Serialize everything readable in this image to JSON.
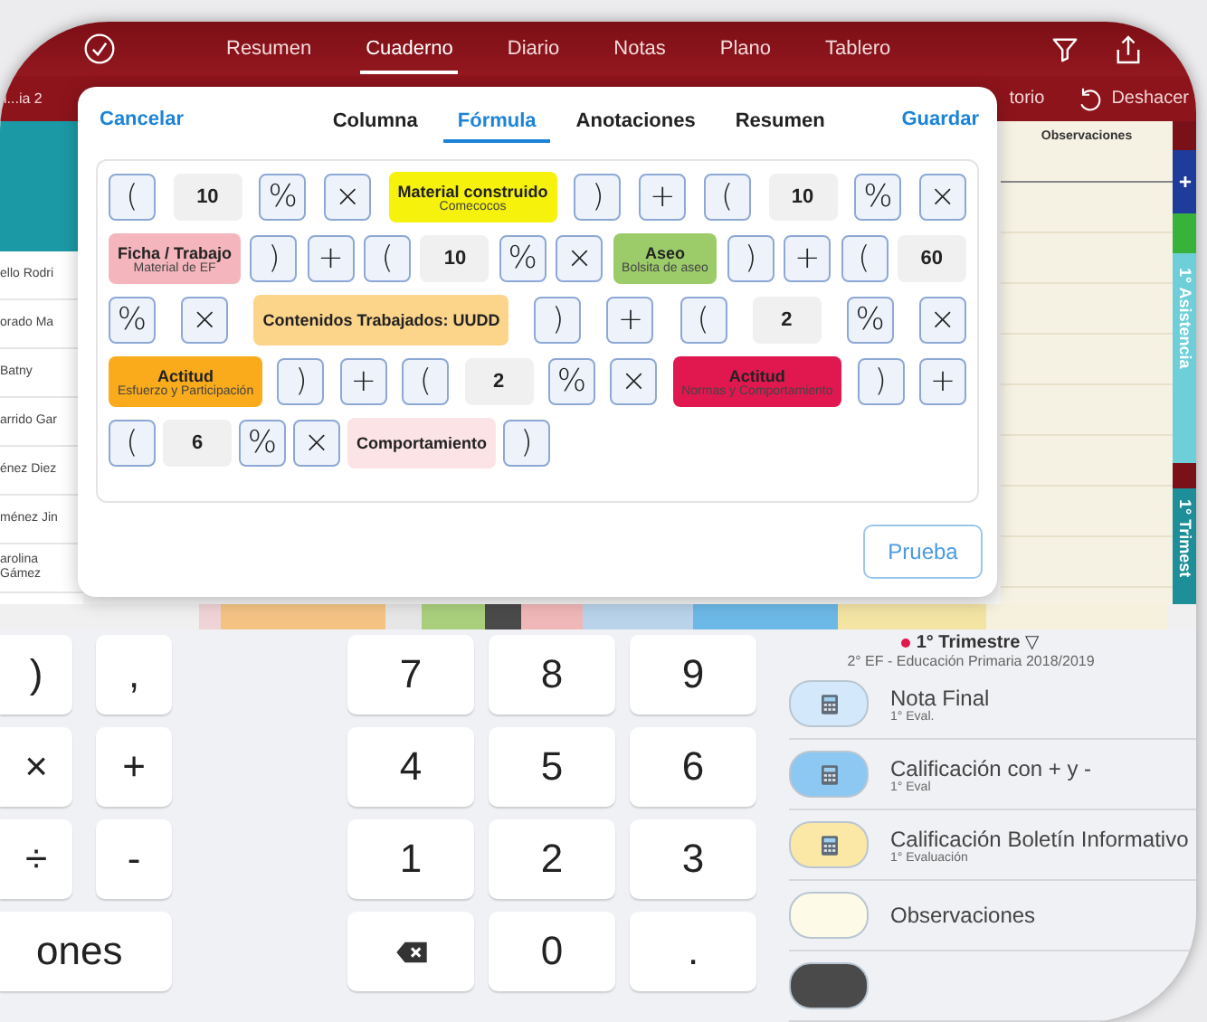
{
  "nav": {
    "tabs": [
      {
        "label": "Resumen",
        "selected": false
      },
      {
        "label": "Cuaderno",
        "selected": true
      },
      {
        "label": "Diario",
        "selected": false
      },
      {
        "label": "Notas",
        "selected": false
      },
      {
        "label": "Plano",
        "selected": false
      },
      {
        "label": "Tablero",
        "selected": false
      }
    ]
  },
  "toolbar": {
    "left_text": "i...ia 2",
    "right_text": "torio",
    "undo": "Deshacer"
  },
  "table": {
    "column_header": "Observaciones",
    "names": [
      "ello Rodri",
      "orado Ma",
      "Batny",
      "arrido Gar",
      "énez Diez",
      "ménez Jin",
      "arolina Gámez"
    ],
    "side_tabs": [
      {
        "label": "+",
        "color": "#1f3c9a"
      },
      {
        "color": "#38b23a"
      },
      {
        "label": "1° Asistencia",
        "color": "#6fcfd8"
      },
      {
        "label": "1° Trimest",
        "color": "#1e8e98"
      }
    ],
    "color_strip": [
      {
        "color": "#f0d3d7"
      },
      {
        "color": "#f4c384"
      },
      {
        "color": "#e6e6e6"
      },
      {
        "color": "#a9cf7c"
      },
      {
        "color": "#4a4a4a"
      },
      {
        "color": "#f0b7b8"
      },
      {
        "color": "#b8d3ea"
      },
      {
        "color": "#6cb8e6"
      },
      {
        "color": "#f3e4a4"
      },
      {
        "color": "#f6f1dc"
      }
    ]
  },
  "dialog": {
    "cancel": "Cancelar",
    "save": "Guardar",
    "tabs": [
      {
        "label": "Columna",
        "selected": false
      },
      {
        "label": "Fórmula",
        "selected": true
      },
      {
        "label": "Anotaciones",
        "selected": false
      },
      {
        "label": "Resumen",
        "selected": false
      }
    ],
    "formula": [
      {
        "tokens": [
          {
            "kind": "sym",
            "text": "("
          },
          {
            "kind": "num",
            "text": "10"
          },
          {
            "kind": "sym",
            "text": "%"
          },
          {
            "kind": "sym",
            "text": "×"
          },
          {
            "kind": "item",
            "title": "Material construido",
            "subtitle": "Comecocos",
            "color": "#f6f20c"
          },
          {
            "kind": "sym",
            "text": ")"
          },
          {
            "kind": "sym",
            "text": "+"
          },
          {
            "kind": "sym",
            "text": "("
          },
          {
            "kind": "num",
            "text": "10"
          },
          {
            "kind": "sym",
            "text": "%"
          },
          {
            "kind": "sym",
            "text": "×"
          }
        ]
      },
      {
        "tokens": [
          {
            "kind": "item",
            "title": "Ficha / Trabajo",
            "subtitle": "Material de EF",
            "color": "#f4b6bc"
          },
          {
            "kind": "sym",
            "text": ")"
          },
          {
            "kind": "sym",
            "text": "+"
          },
          {
            "kind": "sym",
            "text": "("
          },
          {
            "kind": "num",
            "text": "10"
          },
          {
            "kind": "sym",
            "text": "%"
          },
          {
            "kind": "sym",
            "text": "×"
          },
          {
            "kind": "item",
            "title": "Aseo",
            "subtitle": "Bolsita de aseo",
            "color": "#9ccc6a"
          },
          {
            "kind": "sym",
            "text": ")"
          },
          {
            "kind": "sym",
            "text": "+"
          },
          {
            "kind": "sym",
            "text": "("
          },
          {
            "kind": "num",
            "text": "60"
          }
        ]
      },
      {
        "tokens": [
          {
            "kind": "sym",
            "text": "%"
          },
          {
            "kind": "sym",
            "text": "×"
          },
          {
            "kind": "item",
            "title": "Contenidos Trabajados: UUDD",
            "color": "#fcd48a"
          },
          {
            "kind": "sym",
            "text": ")"
          },
          {
            "kind": "sym",
            "text": "+"
          },
          {
            "kind": "sym",
            "text": "("
          },
          {
            "kind": "num",
            "text": "2"
          },
          {
            "kind": "sym",
            "text": "%"
          },
          {
            "kind": "sym",
            "text": "×"
          }
        ]
      },
      {
        "tokens": [
          {
            "kind": "item",
            "title": "Actitud",
            "subtitle": "Esfuerzo y Participación",
            "color": "#f9ab1b"
          },
          {
            "kind": "sym",
            "text": ")"
          },
          {
            "kind": "sym",
            "text": "+"
          },
          {
            "kind": "sym",
            "text": "("
          },
          {
            "kind": "num",
            "text": "2"
          },
          {
            "kind": "sym",
            "text": "%"
          },
          {
            "kind": "sym",
            "text": "×"
          },
          {
            "kind": "item",
            "title": "Actitud",
            "subtitle": "Normas y Comportamiento",
            "color": "#e0184f"
          },
          {
            "kind": "sym",
            "text": ")"
          },
          {
            "kind": "sym",
            "text": "+"
          }
        ]
      },
      {
        "tokens": [
          {
            "kind": "sym",
            "text": "("
          },
          {
            "kind": "num",
            "text": "6"
          },
          {
            "kind": "sym",
            "text": "%"
          },
          {
            "kind": "sym",
            "text": "×"
          },
          {
            "kind": "item",
            "title": "Comportamiento",
            "color": "#fbe3e6"
          },
          {
            "kind": "sym",
            "text": ")"
          }
        ]
      }
    ],
    "test_button": "Prueba"
  },
  "keyboard": {
    "left_keys": [
      {
        "kind": "key",
        "label": ")"
      },
      {
        "kind": "key",
        "label": ","
      },
      {
        "kind": "key",
        "label": "×"
      },
      {
        "kind": "key",
        "label": "+"
      },
      {
        "kind": "key",
        "label": "÷"
      },
      {
        "kind": "key",
        "label": "-"
      },
      {
        "kind": "wide",
        "label": "ones"
      }
    ],
    "numpad": [
      {
        "kind": "key",
        "label": "7"
      },
      {
        "kind": "key",
        "label": "8"
      },
      {
        "kind": "key",
        "label": "9"
      },
      {
        "kind": "key",
        "label": "4"
      },
      {
        "kind": "key",
        "label": "5"
      },
      {
        "kind": "key",
        "label": "6"
      },
      {
        "kind": "key",
        "label": "1"
      },
      {
        "kind": "key",
        "label": "2"
      },
      {
        "kind": "key",
        "label": "3"
      },
      {
        "kind": "delete"
      },
      {
        "kind": "key",
        "label": "0"
      },
      {
        "kind": "key",
        "label": "."
      }
    ]
  },
  "panel": {
    "term": "1° Trimestre",
    "term_caret": "▽",
    "subtitle": "2° EF - Educación Primaria 2018/2019",
    "items": [
      {
        "kind": "calc",
        "title": "Nota Final",
        "subtitle": "1° Eval.",
        "color": "#d3e8fb"
      },
      {
        "kind": "calc",
        "title": "Calificación con + y -",
        "subtitle": "1° Eval",
        "color": "#8cc8f2"
      },
      {
        "kind": "calc",
        "title": "Calificación Boletín Informativo",
        "subtitle": "1° Evaluación",
        "color": "#fbe8a6"
      },
      {
        "kind": "plain",
        "title": "Observaciones",
        "color": "#fdfbe8"
      },
      {
        "kind": "plain",
        "color": "#4a4a4a"
      }
    ]
  }
}
